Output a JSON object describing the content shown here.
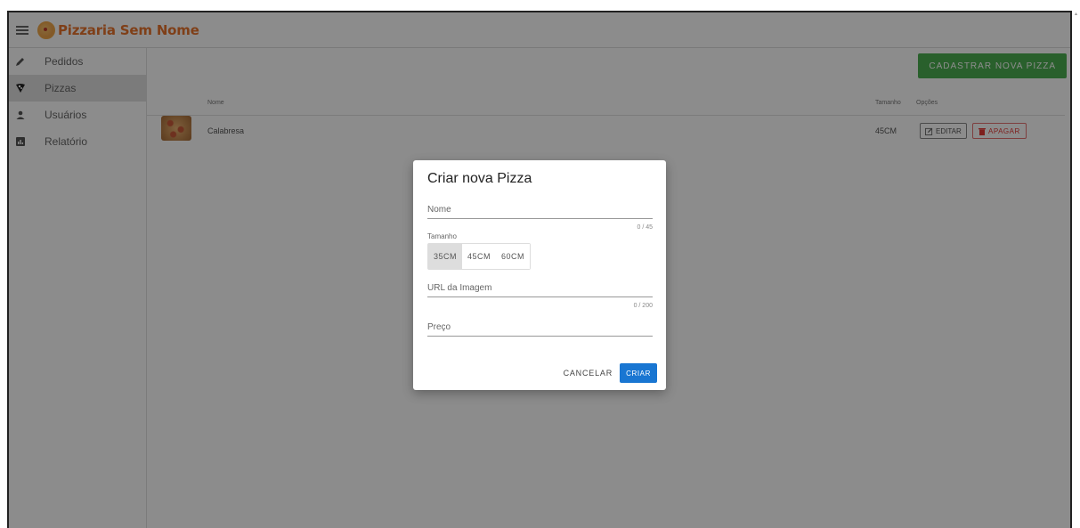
{
  "app": {
    "title": "Pizzaria Sem Nome"
  },
  "sidebar": {
    "items": [
      {
        "label": "Pedidos",
        "icon": "pencil-icon"
      },
      {
        "label": "Pizzas",
        "icon": "pizza-icon"
      },
      {
        "label": "Usuários",
        "icon": "person-icon"
      },
      {
        "label": "Relatório",
        "icon": "chart-icon"
      }
    ],
    "active": "Pizzas"
  },
  "toolbar": {
    "new_pizza_label": "CADASTRAR NOVA PIZZA"
  },
  "table": {
    "headers": {
      "name": "Nome",
      "size": "Tamanho",
      "options": "Opções"
    },
    "rows": [
      {
        "name": "Calabresa",
        "size": "45CM",
        "edit_label": "EDITAR",
        "delete_label": "APAGAR"
      }
    ]
  },
  "dialog": {
    "title": "Criar nova Pizza",
    "name_label": "Nome",
    "name_counter": "0 / 45",
    "size_label": "Tamanho",
    "size_options": [
      "35CM",
      "45CM",
      "60CM"
    ],
    "size_selected": "35CM",
    "image_label": "URL da Imagem",
    "image_counter": "0 / 200",
    "price_label": "Preço",
    "cancel_label": "CANCELAR",
    "create_label": "CRIAR"
  },
  "colors": {
    "brand": "#e8732c",
    "primary": "#1976d2",
    "success": "#4caf50",
    "danger": "#e53935"
  }
}
